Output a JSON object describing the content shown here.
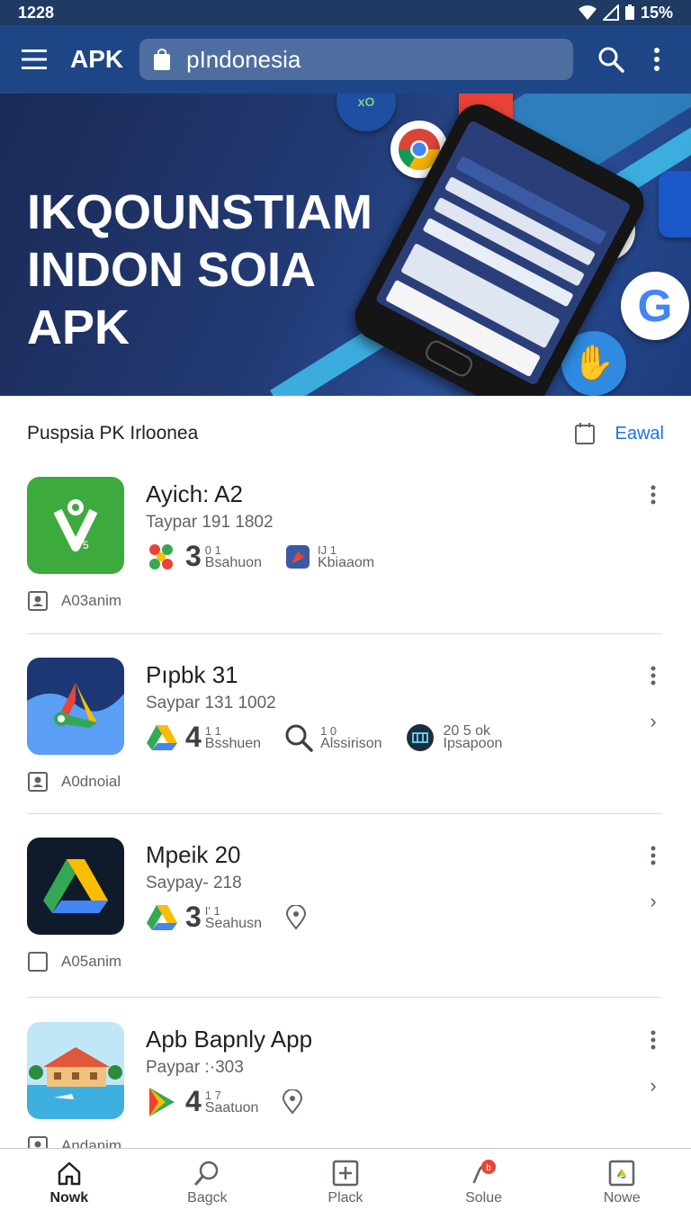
{
  "status_bar": {
    "time": "1228",
    "battery": "15%"
  },
  "app_bar": {
    "title": "APK",
    "search_value": "pIndonesia"
  },
  "banner": {
    "headline_lines": [
      "IKQOUNSTIAM",
      "INDON SOIA",
      "APK"
    ]
  },
  "section": {
    "title": "Puspsia PK Irloonea",
    "link": "Eawal"
  },
  "apps": [
    {
      "name": "Ayich: A2",
      "subtitle": "Taypar 191 1802",
      "stats": [
        {
          "big": "3",
          "top": "0    1",
          "label": "Bsahuon",
          "icon": "flower-icon"
        },
        {
          "big": "",
          "top": "IJ    1",
          "label": "Kbiaaom",
          "icon": "compass-icon"
        }
      ],
      "meta": "A03anim",
      "meta_icon": "contact-icon",
      "icon": "green-app-icon"
    },
    {
      "name": "Pıpbk 31",
      "subtitle": "Saypar 131 1002",
      "stats": [
        {
          "big": "4",
          "top": "1    1",
          "label": "Bsshuen",
          "icon": "drive-icon"
        },
        {
          "big": "",
          "top": "1    0",
          "label": "Alssirison",
          "icon": "search-icon"
        },
        {
          "big": "",
          "top": "20 5 ok",
          "label": "Ipsapoon",
          "icon": "film-icon"
        }
      ],
      "meta": "A0dnoial",
      "meta_icon": "contact-icon",
      "icon": "drive-wave-icon"
    },
    {
      "name": "Mpeik 20",
      "subtitle": "Saypay- 218",
      "stats": [
        {
          "big": "3",
          "top": "I'    1",
          "label": "Seahusn",
          "icon": "drive-icon"
        },
        {
          "big": "",
          "top": "",
          "label": "",
          "icon": "location-icon"
        }
      ],
      "meta": "A05anim",
      "meta_icon": "checkbox-icon",
      "icon": "drive-dark-icon"
    },
    {
      "name": "Apb Bapnly App",
      "subtitle": "Paypar :·303",
      "stats": [
        {
          "big": "4",
          "top": "1    7",
          "label": "Saatuon",
          "icon": "play-icon"
        },
        {
          "big": "",
          "top": "",
          "label": "",
          "icon": "location-icon"
        }
      ],
      "meta": "Andanim",
      "meta_icon": "contact-icon",
      "icon": "house-icon"
    }
  ],
  "bottom_nav": [
    {
      "label": "Nowk",
      "icon": "home-icon",
      "active": true
    },
    {
      "label": "Bagck",
      "icon": "search-icon",
      "active": false
    },
    {
      "label": "Plack",
      "icon": "add-box-icon",
      "active": false
    },
    {
      "label": "Solue",
      "icon": "notification-icon",
      "active": false
    },
    {
      "label": "Nowe",
      "icon": "apps-icon",
      "active": false
    }
  ],
  "colors": {
    "app_bar": "#1e4686",
    "status_bar": "#1f3a63",
    "link": "#1a73e8"
  }
}
